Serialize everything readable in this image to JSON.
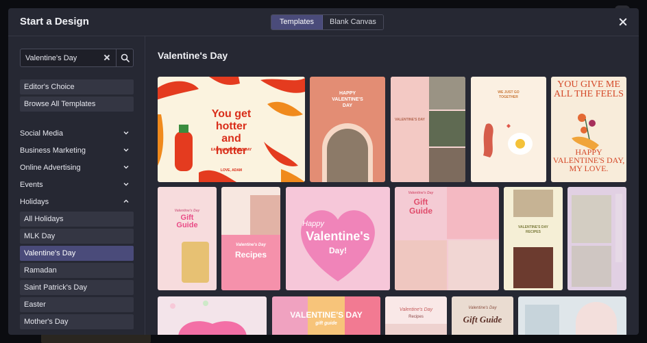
{
  "modal": {
    "title": "Start a Design",
    "tabs": [
      {
        "label": "Templates",
        "active": true
      },
      {
        "label": "Blank Canvas",
        "active": false
      }
    ]
  },
  "sidebar": {
    "search": {
      "value": "Valentine's Day",
      "placeholder": ""
    },
    "quick_links": [
      "Editor's Choice",
      "Browse All Templates"
    ],
    "categories": [
      {
        "label": "Social Media",
        "expanded": false
      },
      {
        "label": "Business Marketing",
        "expanded": false
      },
      {
        "label": "Online Advertising",
        "expanded": false
      },
      {
        "label": "Events",
        "expanded": false
      },
      {
        "label": "Holidays",
        "expanded": true
      }
    ],
    "holiday_items": [
      {
        "label": "All Holidays",
        "active": false
      },
      {
        "label": "MLK Day",
        "active": false
      },
      {
        "label": "Valentine's Day",
        "active": true
      },
      {
        "label": "Ramadan",
        "active": false
      },
      {
        "label": "Saint Patrick's Day",
        "active": false
      },
      {
        "label": "Easter",
        "active": false
      },
      {
        "label": "Mother's Day",
        "active": false
      }
    ]
  },
  "main": {
    "title": "Valentine's Day",
    "templates": {
      "t1": {
        "headline": "You get hotter and hotter",
        "sub": "EACH VALENTINE'S DAY",
        "sign": "LOVE, ADAM"
      },
      "t2": {
        "headline": "HAPPY VALENTINE'S DAY"
      },
      "t3": {
        "headline": "VALENTINE'S DAY"
      },
      "t4": {
        "headline": "WE JUST GO TOGETHER"
      },
      "t5": {
        "top": "YOU GIVE ME ALL THE FEELS",
        "bottom": "HAPPY VALENTINE'S DAY, MY LOVE."
      },
      "t6": {
        "script": "Valentine's Day",
        "headline": "Gift Guide"
      },
      "t7": {
        "script": "Valentine's Day",
        "headline": "Recipes"
      },
      "t8": {
        "script": "Happy",
        "headline": "Valentine's",
        "tail": "Day!"
      },
      "t9": {
        "script": "Valentine's Day",
        "headline": "Gift Guide"
      },
      "t10": {
        "headline": "VALENTINE'S DAY RECIPES"
      },
      "t12": {
        "headline": "VALENTINE'S DAY",
        "sub": "gift guide"
      },
      "t13": {
        "script": "Valentine's Day",
        "headline": "Recipes"
      },
      "t14": {
        "script": "Valentine's Day",
        "headline": "Gift Guide"
      }
    }
  },
  "colors": {
    "accent": "#4a4b7a",
    "panel": "#262833",
    "item": "#343643"
  }
}
